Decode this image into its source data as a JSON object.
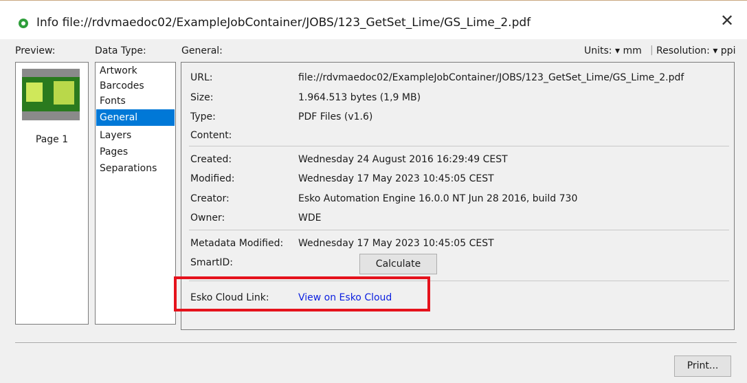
{
  "window": {
    "title": "Info file://rdvmaedoc02/ExampleJobContainer/JOBS/123_GetSet_Lime/GS_Lime_2.pdf",
    "close_glyph": "✕"
  },
  "labels": {
    "preview": "Preview:",
    "data_type": "Data Type:",
    "general": "General:",
    "units": "Units: ▾ mm",
    "resolution": "Resolution: ▾ ppi"
  },
  "preview": {
    "page_label": "Page 1"
  },
  "data_types": [
    {
      "label": "Artwork",
      "selected": false
    },
    {
      "label": "Barcodes",
      "selected": false
    },
    {
      "label": "Fonts",
      "selected": false
    },
    {
      "label": "General",
      "selected": true
    },
    {
      "label": "Layers",
      "selected": false
    },
    {
      "label": "Pages",
      "selected": false
    },
    {
      "label": "Separations",
      "selected": false
    }
  ],
  "general": {
    "url_label": "URL:",
    "url_value": "file://rdvmaedoc02/ExampleJobContainer/JOBS/123_GetSet_Lime/GS_Lime_2.pdf",
    "size_label": "Size:",
    "size_value": "1.964.513 bytes (1,9 MB)",
    "type_label": "Type:",
    "type_value": "PDF Files (v1.6)",
    "content_label": "Content:",
    "created_label": "Created:",
    "created_value": "Wednesday 24 August 2016 16:29:49 CEST",
    "modified_label": "Modified:",
    "modified_value": "Wednesday 17 May 2023 10:45:05 CEST",
    "creator_label": "Creator:",
    "creator_value": "Esko Automation Engine 16.0.0 NT Jun 28 2016, build 730",
    "owner_label": "Owner:",
    "owner_value": "WDE",
    "metadata_modified_label": "Metadata Modified:",
    "metadata_modified_value": "Wednesday 17 May 2023 10:45:05 CEST",
    "smartid_label": "SmartID:",
    "calculate_button": "Calculate",
    "cloud_label": "Esko Cloud Link:",
    "cloud_link": "View on Esko Cloud"
  },
  "footer": {
    "print_button": "Print..."
  },
  "colors": {
    "selection": "#0078d7",
    "link": "#0a1ee0",
    "highlight_box": "#e5121c",
    "title_icon": "#2e9e3a"
  }
}
